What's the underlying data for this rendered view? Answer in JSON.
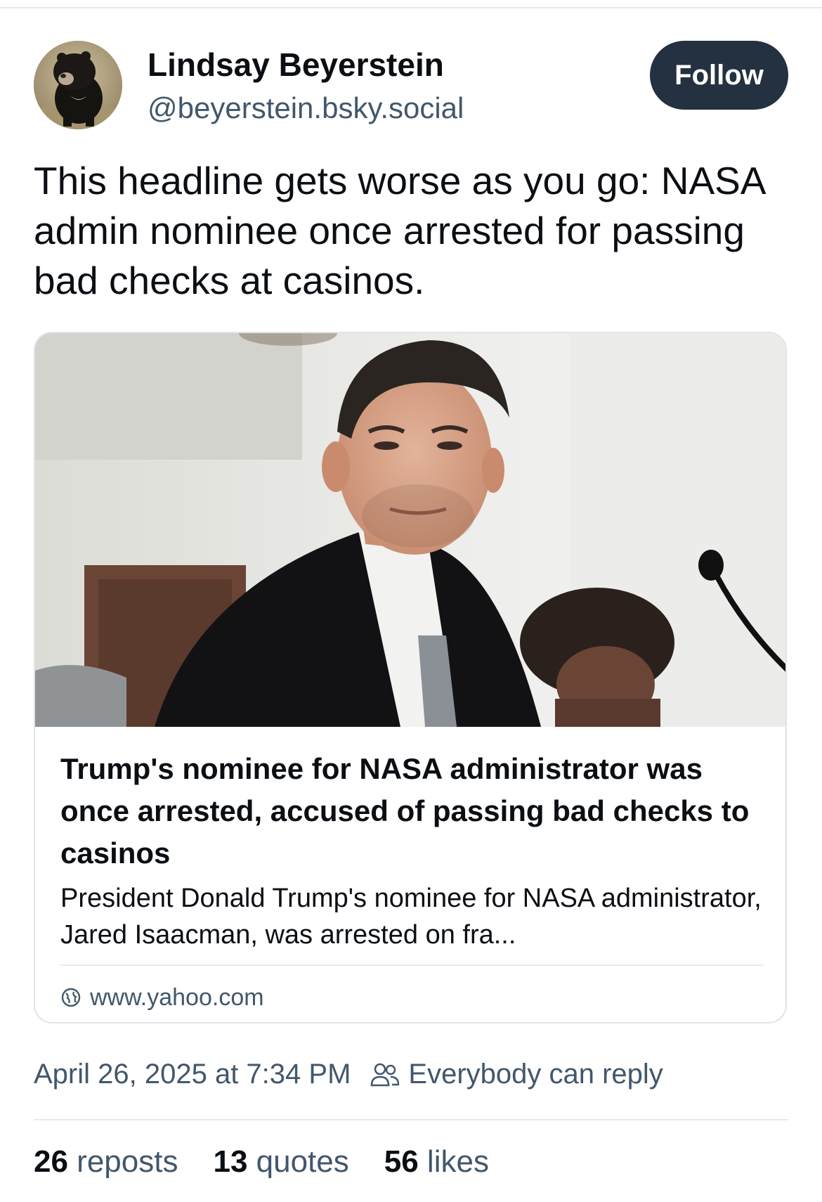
{
  "author": {
    "name": "Lindsay Beyerstein",
    "handle": "@beyerstein.bsky.social",
    "avatar_icon": "sloth-bear-avatar"
  },
  "follow_button": {
    "label": "Follow"
  },
  "post": {
    "text": "This headline gets worse as you go: NASA admin nominee once arrested for passing bad checks at casinos."
  },
  "link_card": {
    "image_icon": "man-in-suit-at-hearing-photo",
    "title": "Trump's nominee for NASA administrator was once arrested, accused of passing bad checks to casinos",
    "description": "President Donald Trump's nominee for NASA administrator, Jared Isaacman, was arrested on fra...",
    "domain": "www.yahoo.com",
    "domain_icon": "globe-icon"
  },
  "meta": {
    "timestamp": "April 26, 2025 at 7:34 PM",
    "reply_setting": "Everybody can reply",
    "reply_icon": "people-icon"
  },
  "stats": {
    "reposts_count": "26",
    "reposts_label": "reposts",
    "quotes_count": "13",
    "quotes_label": "quotes",
    "likes_count": "56",
    "likes_label": "likes"
  },
  "colors": {
    "follow_button_bg": "#243140",
    "secondary_text": "#42576c",
    "border": "#dfe4ea"
  }
}
